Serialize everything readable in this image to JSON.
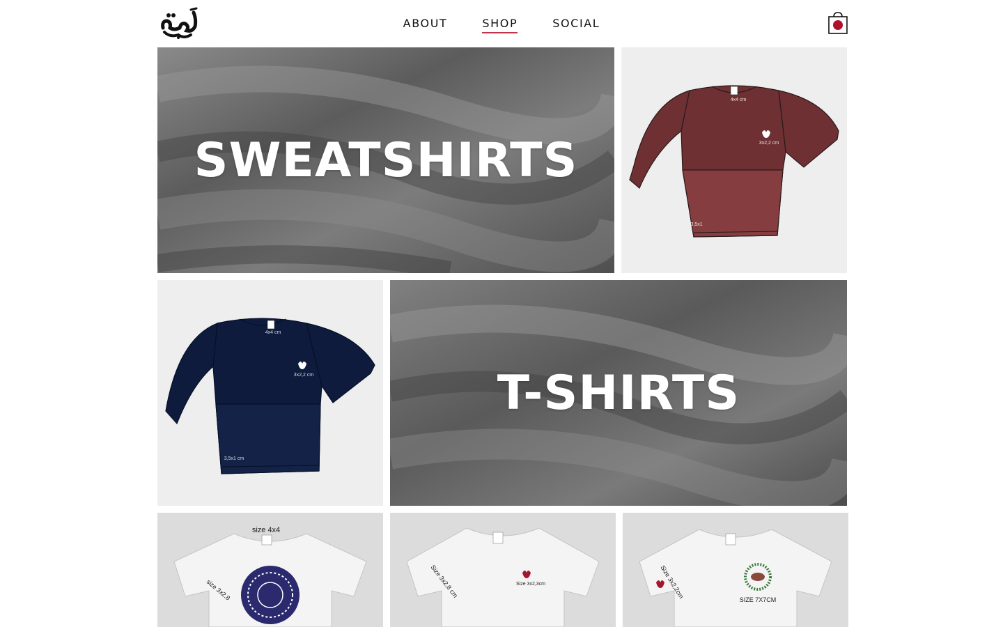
{
  "brand": {
    "logo_alt": "نغمة"
  },
  "nav": {
    "items": [
      {
        "label": "ABOUT",
        "active": false
      },
      {
        "label": "SHOP",
        "active": true
      },
      {
        "label": "SOCIAL",
        "active": false
      }
    ],
    "accent_color": "#c0344e"
  },
  "cart": {
    "icon": "shopping-bag-icon",
    "indicator_color": "#b0112e"
  },
  "categories": {
    "sweatshirts_label": "SWEATSHIRTS",
    "tshirts_label": "T-SHIRTS"
  },
  "products": {
    "red_sweatshirt": {
      "color": "#7a3438",
      "neck_size": "4x4 cm",
      "chest_size": "3x2,2 cm",
      "hem_size": "3,5x1"
    },
    "navy_sweatshirt": {
      "color": "#0e1b3d",
      "neck_size": "4x4 cm",
      "chest_size": "3x2,2 cm",
      "hem_size": "3,5x1 cm"
    },
    "tee_1": {
      "neck_label": "size 4x4",
      "sleeve_label": "size 3x2.8"
    },
    "tee_2": {
      "sleeve_label": "Size 3x2,8 cm",
      "chest_label": "Size 3x2,3cm"
    },
    "tee_3": {
      "sleeve_label": "Size 3x2,2cm",
      "chest_label": "SIZE 7X7CM"
    }
  }
}
